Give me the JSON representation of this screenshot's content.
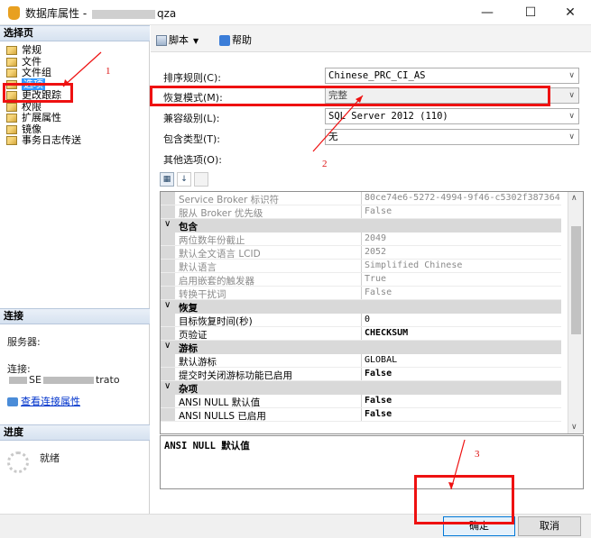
{
  "window": {
    "title_prefix": "数据库属性 - ",
    "title_suffix": "qza",
    "minimize_glyph": "—",
    "maximize_glyph": "☐",
    "close_glyph": "✕"
  },
  "left_panel": {
    "select_page_header": "选择页",
    "pages": [
      {
        "label": "常规"
      },
      {
        "label": "文件"
      },
      {
        "label": "文件组"
      },
      {
        "label": "选项"
      },
      {
        "label": "更改跟踪"
      },
      {
        "label": "权限"
      },
      {
        "label": "扩展属性"
      },
      {
        "label": "镜像"
      },
      {
        "label": "事务日志传送"
      }
    ],
    "connection_header": "连接",
    "server_label": "服务器:",
    "connection_label": "连接:",
    "connection_value_visible": "SE",
    "connection_value_tail": "trato",
    "view_connection_link": "查看连接属性",
    "progress_header": "进度",
    "progress_status": "就绪"
  },
  "toolbar": {
    "script_label": "脚本",
    "help_label": "帮助"
  },
  "form": {
    "collation_label": "排序规则(C):",
    "collation_value": "Chinese_PRC_CI_AS",
    "recovery_label": "恢复模式(M):",
    "recovery_value": "完整",
    "compat_label": "兼容级别(L):",
    "compat_value": "SQL Server 2012 (110)",
    "containment_label": "包含类型(T):",
    "containment_value": "无",
    "other_options_label": "其他选项(O):"
  },
  "property_grid": {
    "rows": [
      {
        "kind": "item",
        "style": "dim",
        "name": "Service Broker 标识符",
        "value": "80ce74e6-5272-4994-9f46-c5302f387364"
      },
      {
        "kind": "item",
        "style": "dim",
        "name": "服从 Broker 优先级",
        "value": "False"
      },
      {
        "kind": "cat",
        "name": "包含"
      },
      {
        "kind": "item",
        "style": "dim",
        "name": "两位数年份截止",
        "value": "2049"
      },
      {
        "kind": "item",
        "style": "dim",
        "name": "默认全文语言 LCID",
        "value": "2052"
      },
      {
        "kind": "item",
        "style": "dim",
        "name": "默认语言",
        "value": "Simplified Chinese"
      },
      {
        "kind": "item",
        "style": "dim",
        "name": "启用嵌套的触发器",
        "value": "True"
      },
      {
        "kind": "item",
        "style": "dim",
        "name": "转换干扰词",
        "value": "False"
      },
      {
        "kind": "cat",
        "name": "恢复"
      },
      {
        "kind": "item",
        "style": "normal",
        "name": "目标恢复时间(秒)",
        "value": "0"
      },
      {
        "kind": "item",
        "style": "bold",
        "name": "页验证",
        "value": "CHECKSUM"
      },
      {
        "kind": "cat",
        "name": "游标"
      },
      {
        "kind": "item",
        "style": "normal",
        "name": "默认游标",
        "value": "GLOBAL"
      },
      {
        "kind": "item",
        "style": "bold",
        "name": "提交时关闭游标功能已启用",
        "value": "False"
      },
      {
        "kind": "cat",
        "name": "杂项"
      },
      {
        "kind": "item",
        "style": "bold",
        "name": "ANSI NULL 默认值",
        "value": "False"
      },
      {
        "kind": "item",
        "style": "bold",
        "name": "ANSI NULLS 已启用",
        "value": "False"
      }
    ],
    "description": "ANSI NULL 默认值"
  },
  "buttons": {
    "ok": "确定",
    "cancel": "取消"
  },
  "annotations": {
    "one": "1",
    "two": "2",
    "three": "3",
    "color": "#ee1111"
  }
}
